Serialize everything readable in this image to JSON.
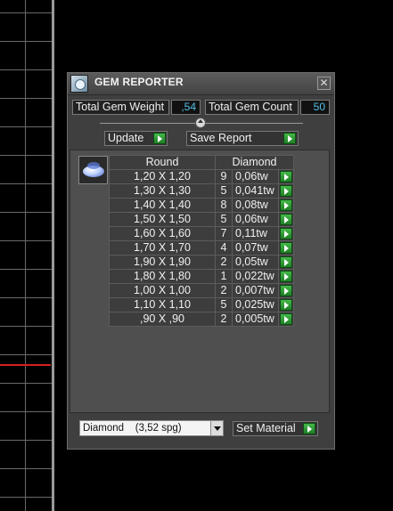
{
  "window": {
    "title": "GEM REPORTER",
    "close_glyph": "✕",
    "icon": "gem-reporter-app-icon"
  },
  "totals": {
    "weight_label": "Total Gem Weight",
    "weight_value": ",54",
    "count_label": "Total Gem Count",
    "count_value": "50"
  },
  "buttons": {
    "update": "Update",
    "save_report": "Save Report",
    "set_material": "Set Material"
  },
  "table": {
    "headers": [
      "Round",
      "Diamond"
    ],
    "rows": [
      {
        "size": "1,20 X 1,20",
        "count": "9",
        "weight": "0,06tw"
      },
      {
        "size": "1,30 X 1,30",
        "count": "5",
        "weight": "0,041tw"
      },
      {
        "size": "1,40 X 1,40",
        "count": "8",
        "weight": "0,08tw"
      },
      {
        "size": "1,50 X 1,50",
        "count": "5",
        "weight": "0,06tw"
      },
      {
        "size": "1,60 X 1,60",
        "count": "7",
        "weight": "0,11tw"
      },
      {
        "size": "1,70 X 1,70",
        "count": "4",
        "weight": "0,07tw"
      },
      {
        "size": "1,90 X 1,90",
        "count": "2",
        "weight": "0,05tw"
      },
      {
        "size": "1,80 X 1,80",
        "count": "1",
        "weight": "0,022tw"
      },
      {
        "size": "1,00 X 1,00",
        "count": "2",
        "weight": "0,007tw"
      },
      {
        "size": "1,10 X 1,10",
        "count": "5",
        "weight": "0,025tw"
      },
      {
        "size": ",90 X ,90",
        "count": "2",
        "weight": "0,005tw"
      }
    ]
  },
  "material": {
    "selected": "Diamond    (3,52 spg)"
  },
  "colors": {
    "value_text": "#55bfe6",
    "go_button": "#2f9a35",
    "panel_bg": "#3f3f3f"
  }
}
